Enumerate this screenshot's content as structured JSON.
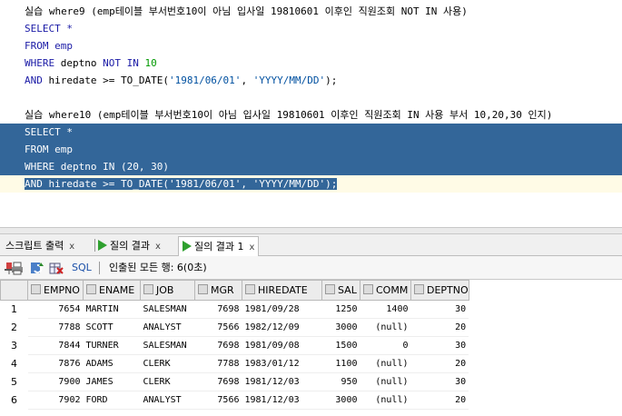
{
  "editor": {
    "comment1": "실습 where9 (emp테이블 부서번호10이 아님 입사일 19810601 이후인 직원조회 NOT IN 사용)",
    "q1_l1": "SELECT *",
    "q1_l2": "FROM emp",
    "q1_l3_kw": "WHERE",
    "q1_l3_mid": " deptno ",
    "q1_l3_kw2": "NOT IN",
    "q1_l3_num": " 10",
    "q1_l4_kw": "AND",
    "q1_l4_mid": " hiredate >= TO_DATE(",
    "q1_l4_s1": "'1981/06/01'",
    "q1_l4_c": ", ",
    "q1_l4_s2": "'YYYY/MM/DD'",
    "q1_l4_end": ");",
    "comment2": "실습 where10 (emp테이블 부서번호10이 아님 입사일 19810601 이후인 직원조회 IN 사용 부서 10,20,30 인지)",
    "q2_l1": "SELECT *",
    "q2_l2": "FROM emp",
    "q2_l3": "WHERE deptno IN (20, 30)",
    "q2_l4": "AND hiredate >= TO_DATE('1981/06/01', 'YYYY/MM/DD');"
  },
  "tabs": [
    {
      "label": "스크립트 출력",
      "close": "x"
    },
    {
      "label": "질의 결과",
      "close": "x"
    },
    {
      "label": "질의 결과 1",
      "close": "x"
    }
  ],
  "toolbar": {
    "sql_label": "SQL",
    "status": "인출된 모든 행: 6(0초)"
  },
  "results": {
    "columns": [
      "EMPNO",
      "ENAME",
      "JOB",
      "MGR",
      "HIREDATE",
      "SAL",
      "COMM",
      "DEPTNO"
    ],
    "rows": [
      [
        "1",
        "7654",
        "MARTIN",
        "SALESMAN",
        "7698",
        "1981/09/28",
        "1250",
        "1400",
        "30"
      ],
      [
        "2",
        "7788",
        "SCOTT",
        "ANALYST",
        "7566",
        "1982/12/09",
        "3000",
        "(null)",
        "20"
      ],
      [
        "3",
        "7844",
        "TURNER",
        "SALESMAN",
        "7698",
        "1981/09/08",
        "1500",
        "0",
        "30"
      ],
      [
        "4",
        "7876",
        "ADAMS",
        "CLERK",
        "7788",
        "1983/01/12",
        "1100",
        "(null)",
        "20"
      ],
      [
        "5",
        "7900",
        "JAMES",
        "CLERK",
        "7698",
        "1981/12/03",
        "950",
        "(null)",
        "30"
      ],
      [
        "6",
        "7902",
        "FORD",
        "ANALYST",
        "7566",
        "1981/12/03",
        "3000",
        "(null)",
        "20"
      ]
    ]
  },
  "colors": {
    "selection": "#336699",
    "keyword": "#1a1aa6",
    "number": "#009900",
    "run_icon": "#2ea02e"
  }
}
